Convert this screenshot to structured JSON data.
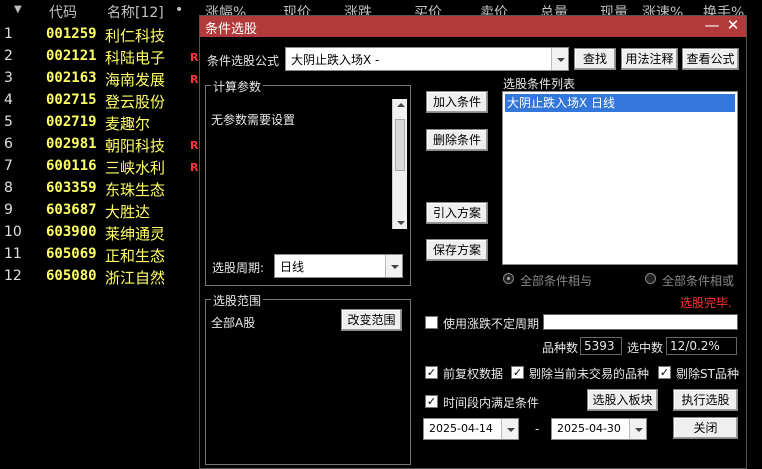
{
  "stock_list": {
    "headers": [
      "代码",
      "名称[12]",
      "•",
      "涨幅%",
      "现价",
      "涨跌",
      "买价",
      "卖价",
      "总量",
      "现量",
      "涨速%",
      "换手%"
    ],
    "rows": [
      {
        "idx": "1",
        "code": "001259",
        "name": "利仁科技",
        "flag": ""
      },
      {
        "idx": "2",
        "code": "002121",
        "name": "科陆电子",
        "flag": "R"
      },
      {
        "idx": "3",
        "code": "002163",
        "name": "海南发展",
        "flag": "R"
      },
      {
        "idx": "4",
        "code": "002715",
        "name": "登云股份",
        "flag": ""
      },
      {
        "idx": "5",
        "code": "002719",
        "name": "麦趣尔",
        "flag": ""
      },
      {
        "idx": "6",
        "code": "002981",
        "name": "朝阳科技",
        "flag": "R"
      },
      {
        "idx": "7",
        "code": "600116",
        "name": "三峡水利",
        "flag": "R"
      },
      {
        "idx": "8",
        "code": "603359",
        "name": "东珠生态",
        "flag": ""
      },
      {
        "idx": "9",
        "code": "603687",
        "name": "大胜达",
        "flag": ""
      },
      {
        "idx": "10",
        "code": "603900",
        "name": "莱绅通灵",
        "flag": ""
      },
      {
        "idx": "11",
        "code": "605069",
        "name": "正和生态",
        "flag": ""
      },
      {
        "idx": "12",
        "code": "605080",
        "name": "浙江自然",
        "flag": ""
      }
    ]
  },
  "dialog": {
    "title": "条件选股",
    "formula_label": "条件选股公式",
    "formula_value": "大阴止跌入场X -",
    "find_button": "查找",
    "usage_button": "用法注释",
    "view_formula_button": "查看公式",
    "params_group": "计算参数",
    "params_text": "无参数需要设置",
    "period_label": "选股周期:",
    "period_value": "日线",
    "add_condition_button": "加入条件",
    "delete_condition_button": "删除条件",
    "import_plan_button": "引入方案",
    "save_plan_button": "保存方案",
    "conditions_list_label": "选股条件列表",
    "conditions": [
      "大阴止跌入场X  日线"
    ],
    "radio_and": "全部条件相与",
    "radio_or": "全部条件相或",
    "status": "选股完毕.",
    "status_color": "#ff3333",
    "scope_group": "选股范围",
    "scope_value": "全部A股",
    "change_scope_button": "改变范围",
    "use_unfixed_period": "使用涨跌不定周期",
    "variety_count_label": "品种数",
    "variety_count": "5393",
    "selected_count_label": "选中数",
    "selected_count": "12/0.2%",
    "forward_adjust": "前复权数据",
    "exclude_untraded": "剔除当前未交易的品种",
    "exclude_st": "剔除ST品种",
    "time_range_label": "时间段内满足条件",
    "select_to_board_button": "选股入板块",
    "execute_button": "执行选股",
    "date_from": "2025-04-14",
    "date_sep": "-",
    "date_to": "2025-04-30",
    "close_button": "关闭"
  }
}
